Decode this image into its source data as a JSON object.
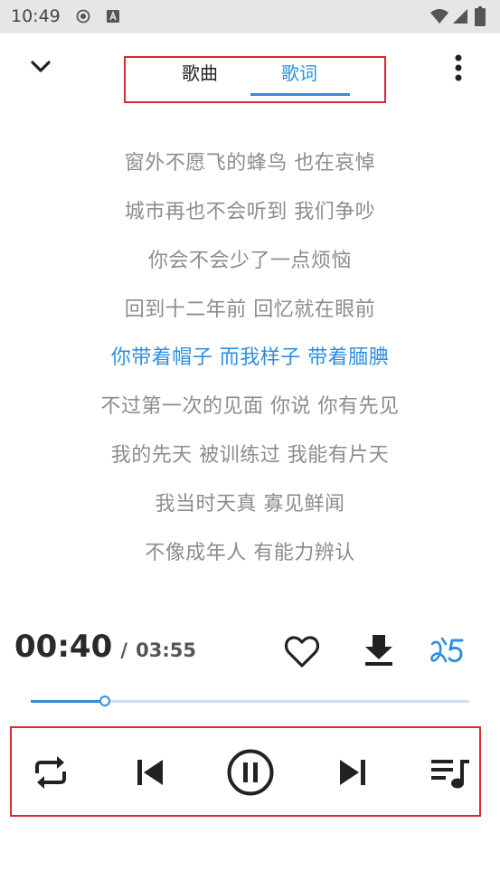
{
  "status_bar": {
    "time": "10:49",
    "icons": [
      "record-icon",
      "a-app-icon",
      "wifi-icon",
      "signal-icon",
      "battery-icon"
    ]
  },
  "header": {
    "back_icon": "chevron-down-icon",
    "tabs": [
      {
        "label": "歌曲",
        "active": false
      },
      {
        "label": "歌词",
        "active": true
      }
    ],
    "more_icon": "more-vertical-icon"
  },
  "lyrics": {
    "lines": [
      "窗外不愿飞的蜂鸟 也在哀悼",
      "城市再也不会听到 我们争吵",
      "你会不会少了一点烦恼",
      "回到十二年前 回忆就在眼前",
      "你带着帽子 而我样子 带着腼腆",
      "不过第一次的见面 你说 你有先见",
      "我的先天 被训练过 我能有片天",
      "我当时天真 寡见鲜闻",
      "不像成年人 有能力辨认"
    ],
    "active_index": 4
  },
  "player": {
    "current_time": "00:40",
    "separator": "/",
    "total_time": "03:55",
    "progress": 0.17,
    "actions": [
      "heart-icon",
      "download-icon",
      "source-logo-icon"
    ]
  },
  "controls": {
    "icons": [
      "repeat-icon",
      "skip-previous-icon",
      "pause-icon",
      "skip-next-icon",
      "playlist-icon"
    ]
  },
  "colors": {
    "accent": "#2f8ee0",
    "lyric_inactive": "#8c8c8c",
    "highlight_box": "#e0262f",
    "status_bar_bg": "#e6e6e6"
  }
}
